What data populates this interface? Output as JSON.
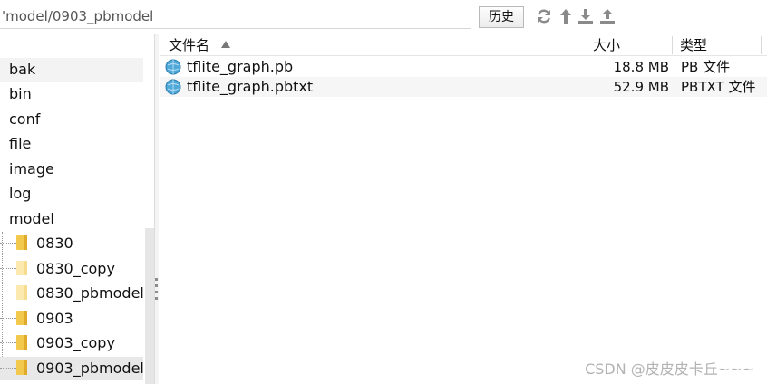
{
  "pathbar": {
    "path": "         'model/0903_pbmodel",
    "history_label": "历史",
    "icons": [
      "refresh-icon",
      "up-arrow-icon",
      "download-icon",
      "upload-icon"
    ]
  },
  "tree": {
    "top_items": [
      "bak",
      "bin",
      "conf",
      "file",
      "image",
      "log",
      "model"
    ],
    "sub_items": [
      {
        "label": "0830",
        "color": "#f2c94c"
      },
      {
        "label": "0830_copy",
        "color": "#fbe9b0"
      },
      {
        "label": "0830_pbmodel",
        "color": "#fbe9b0"
      },
      {
        "label": "0903",
        "color": "#f2c94c"
      },
      {
        "label": "0903_copy",
        "color": "#f2c94c"
      },
      {
        "label": "0903_pbmodel",
        "color": "#f2c94c",
        "selected": true
      }
    ]
  },
  "list": {
    "headers": {
      "name": "文件名",
      "size": "大小",
      "type": "类型"
    },
    "rows": [
      {
        "name": "tflite_graph.pb",
        "size": "18.8 MB",
        "type": "PB 文件"
      },
      {
        "name": "tflite_graph.pbtxt",
        "size": "52.9 MB",
        "type": "PBTXT 文件"
      }
    ]
  },
  "watermark": "CSDN @皮皮皮卡丘~~~",
  "colors": {
    "folder": "#f2c94c",
    "folder_light": "#fbe9b0",
    "file_icon": "#4fa8d8",
    "selected_row": "#e8e8e8"
  }
}
